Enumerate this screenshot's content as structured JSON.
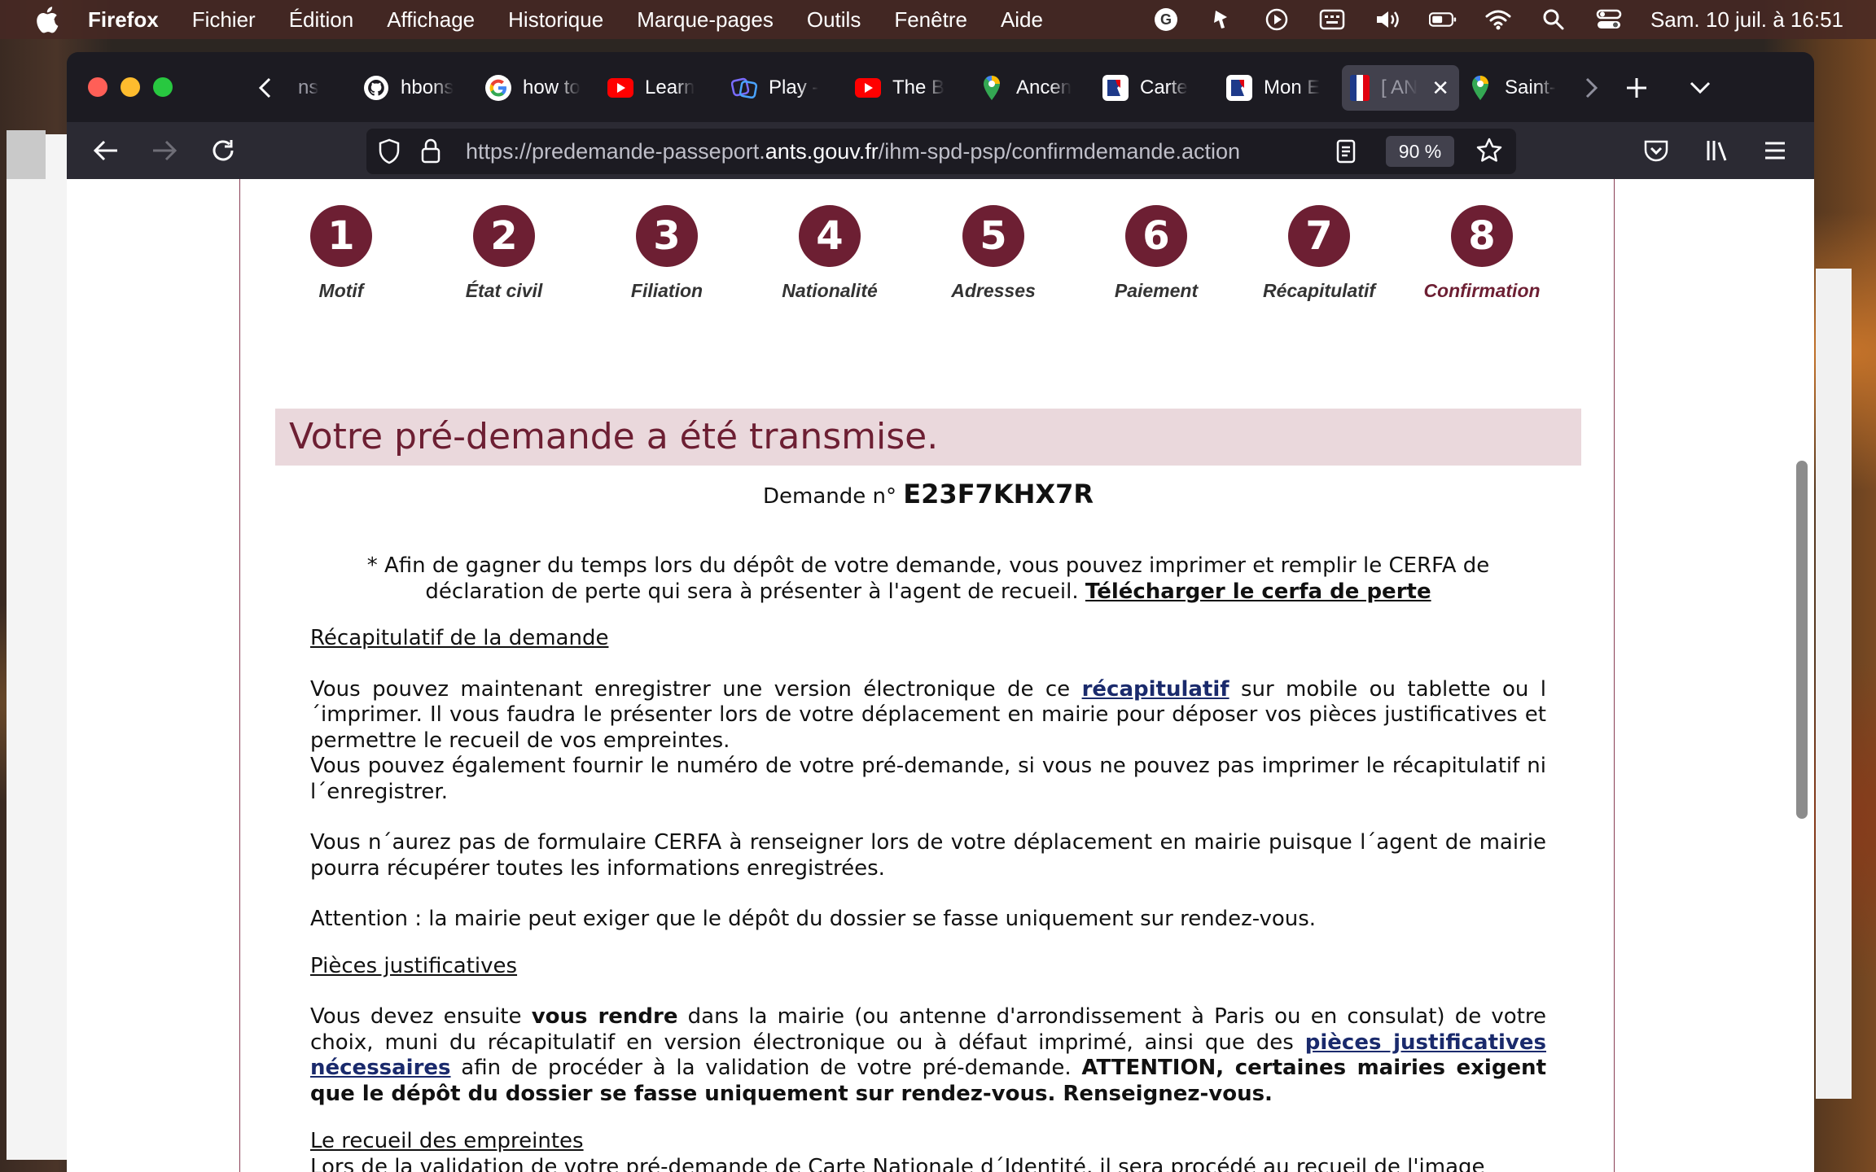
{
  "menubar": {
    "items": [
      "Firefox",
      "Fichier",
      "Édition",
      "Affichage",
      "Historique",
      "Marque-pages",
      "Outils",
      "Fenêtre",
      "Aide"
    ],
    "clock": "Sam. 10 juil. à 16:51"
  },
  "tabs": [
    {
      "title": "ns",
      "icon": "partial-tab-icon",
      "color": "#1c1b22"
    },
    {
      "title": "hbons",
      "icon": "github-icon",
      "color": "#ffffff"
    },
    {
      "title": "how to",
      "icon": "google-icon",
      "color": "#ffffff"
    },
    {
      "title": "Learn",
      "icon": "youtube-icon",
      "color": "#ff0000"
    },
    {
      "title": "Play -",
      "icon": "play-icon",
      "color": "#7a6cff"
    },
    {
      "title": "The B",
      "icon": "youtube-icon",
      "color": "#ff0000"
    },
    {
      "title": "Ancen",
      "icon": "maps-pin-icon",
      "color": "#34a853"
    },
    {
      "title": "Carte",
      "icon": "marianne-icon",
      "color": "#1e3a8a"
    },
    {
      "title": "Mon E",
      "icon": "marianne-icon",
      "color": "#1e3a8a"
    },
    {
      "title": "[ AN",
      "icon": "flag-icon",
      "color": "#ffffff"
    },
    {
      "title": "Saint-",
      "icon": "maps-pin-icon",
      "color": "#34a853"
    }
  ],
  "urlbar": {
    "url_prefix": "https://predemande-passeport.",
    "url_domain": "ants.gouv.fr",
    "url_suffix": "/ihm-spd-psp/confirmdemande.action",
    "zoom": "90 %"
  },
  "steps": [
    {
      "num": "1",
      "label": "Motif"
    },
    {
      "num": "2",
      "label": "État civil"
    },
    {
      "num": "3",
      "label": "Filiation"
    },
    {
      "num": "4",
      "label": "Nationalité"
    },
    {
      "num": "5",
      "label": "Adresses"
    },
    {
      "num": "6",
      "label": "Paiement"
    },
    {
      "num": "7",
      "label": "Récapitulatif"
    },
    {
      "num": "8",
      "label": "Confirmation"
    }
  ],
  "current_step": "8",
  "banner": "Votre pré-demande a été transmise.",
  "demande": {
    "label": "Demande n°",
    "number": "E23F7KHX7R"
  },
  "cerfa": {
    "text": "* Afin de gagner du temps lors du dépôt de votre demande, vous pouvez imprimer et remplir le CERFA de déclaration de perte qui sera à présenter à l'agent de recueil.",
    "link": "Télécharger le cerfa de perte"
  },
  "sections": {
    "recap_title": "Récapitulatif de la demande",
    "recap_p1_before": "Vous pouvez maintenant enregistrer une version électronique de ce",
    "recap_p1_link": "récapitulatif",
    "recap_p1_after": "sur mobile ou tablette ou l´imprimer. Il vous faudra le présenter lors de votre déplacement en mairie pour déposer vos pièces justificatives et permettre le recueil de vos empreintes.",
    "recap_p2": "Vous pouvez également fournir le numéro de votre pré-demande, si vous ne pouvez pas imprimer le récapitulatif ni l´enregistrer.",
    "recap_p3": "Vous n´aurez pas de formulaire CERFA à renseigner lors de votre déplacement en mairie puisque l´agent de mairie pourra récupérer toutes les informations enregistrées.",
    "recap_p4": "Attention : la mairie peut exiger que le dépôt du dossier se fasse uniquement sur rendez-vous.",
    "pieces_title": "Pièces justificatives",
    "pieces_p_start": "Vous devez ensuite",
    "pieces_p_bold": "vous rendre",
    "pieces_p_mid": "dans la mairie (ou antenne d'arrondissement à Paris ou en consulat) de votre choix, muni du récapitulatif en version électronique ou à défaut imprimé, ainsi que des",
    "pieces_p_link": "pièces justificatives nécessaires",
    "pieces_p_after": "afin de procéder à la validation de votre pré-demande.",
    "pieces_p_warning": "ATTENTION, certaines mairies exigent que le dépôt du dossier se fasse uniquement sur rendez-vous. Renseignez-vous.",
    "empreintes_title": "Le recueil des empreintes",
    "empreintes_p": "Lors de la validation de votre pré-demande de Carte Nationale d´Identité, il sera procédé au recueil de l'image"
  }
}
